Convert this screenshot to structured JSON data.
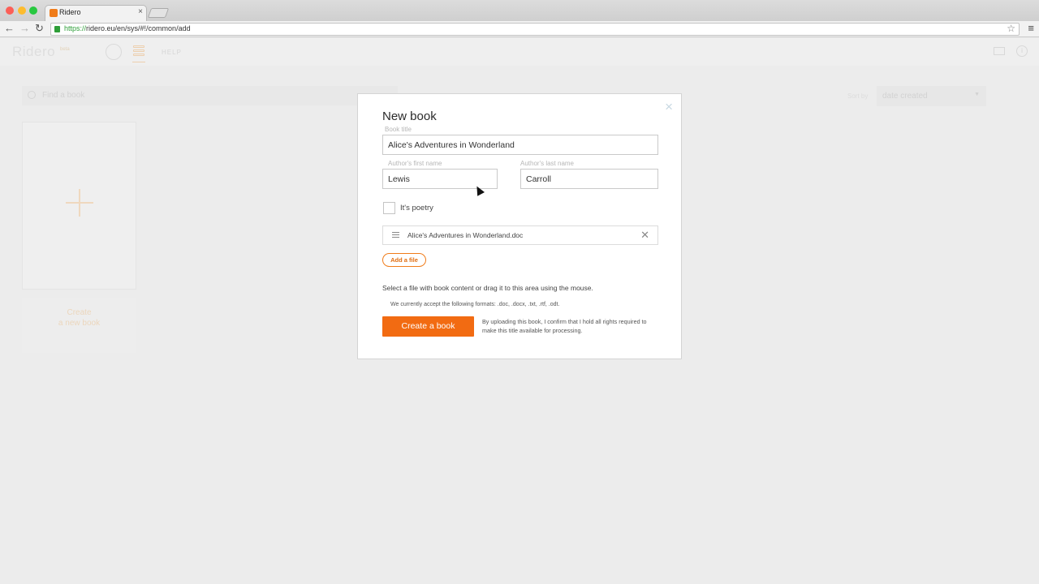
{
  "browser": {
    "tab_title": "Ridero",
    "tab_close": "×",
    "url_scheme": "https://",
    "url_rest": "ridero.eu/en/sys/#!/common/add",
    "back_icon": "←",
    "forward_icon": "→",
    "reload_icon": "↻",
    "bookmark_icon": "☆",
    "menu_icon": "≡"
  },
  "app": {
    "logo": "Ridero",
    "logo_tag": "beta",
    "help": "HELP",
    "info_icon": "i",
    "search_placeholder": "Find a book",
    "sort_label": "Sort by",
    "sort_value": "date created",
    "sort_caret": "▼",
    "create_caption_line1": "Create",
    "create_caption_line2": "a new book"
  },
  "modal": {
    "close": "×",
    "title": "New book",
    "book_title_label": "Book title",
    "book_title_value": "Alice's Adventures in Wonderland",
    "first_name_label": "Author's first name",
    "first_name_value": "Lewis",
    "last_name_label": "Author's last name",
    "last_name_value": "Carroll",
    "poetry_label": "It's poetry",
    "poetry_checked": false,
    "file_name": "Alice's Adventures in Wonderland.doc",
    "file_remove": "✕",
    "add_file": "Add a file",
    "hint_select": "Select a file with book content or drag it to this area using the mouse.",
    "hint_formats": "We currently accept the following formats: .doc, .docx, .txt, .rtf, .odt.",
    "create_button": "Create a book",
    "confirm_text": "By uploading this book, I confirm that I hold all rights required to make this title available for processing."
  },
  "colors": {
    "accent": "#f26b12",
    "accent_outline": "#f07c1a"
  }
}
